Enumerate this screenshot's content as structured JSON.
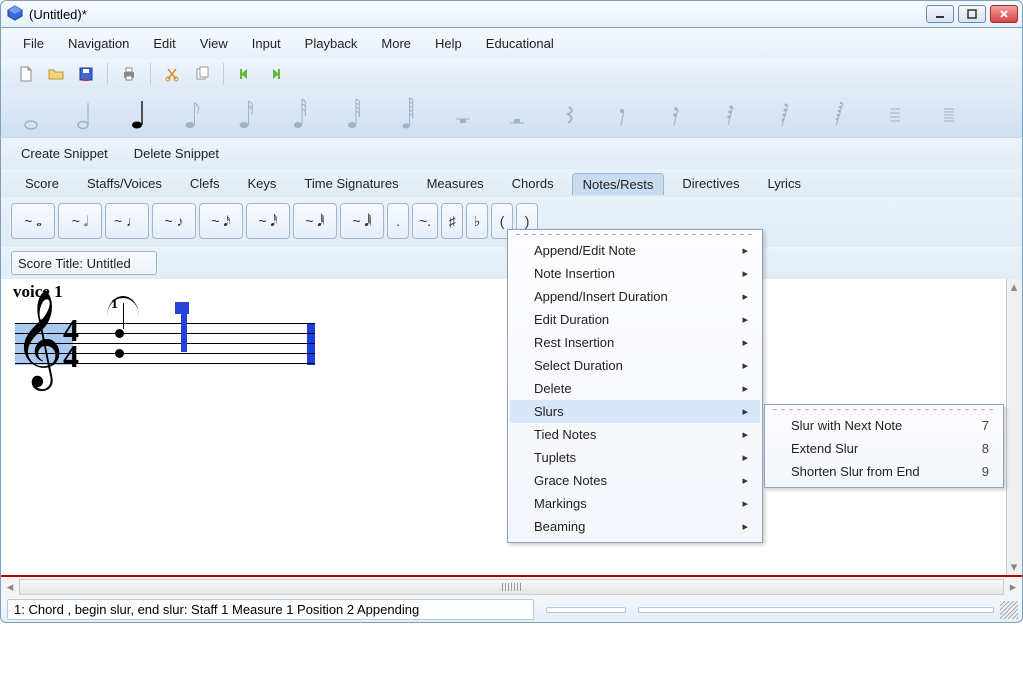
{
  "window": {
    "title": "(Untitled)*"
  },
  "menu": {
    "items": [
      "File",
      "Navigation",
      "Edit",
      "View",
      "Input",
      "Playback",
      "More",
      "Help",
      "Educational"
    ]
  },
  "snippet": {
    "create": "Create Snippet",
    "delete": "Delete Snippet"
  },
  "tabs": {
    "items": [
      "Score",
      "Staffs/Voices",
      "Clefs",
      "Keys",
      "Time Signatures",
      "Measures",
      "Chords",
      "Notes/Rests",
      "Directives",
      "Lyrics"
    ],
    "active_index": 7
  },
  "palette": {
    "items": [
      "~ 𝅝",
      "~ 𝅗𝅥",
      "~ ♩",
      "~ ♪",
      "~ 𝅘𝅥𝅯",
      "~ 𝅘𝅥𝅰",
      "~ 𝅘𝅥𝅱",
      "~ 𝅘𝅥𝅲",
      ".",
      "~.",
      "♯",
      "♭",
      "(",
      ")"
    ]
  },
  "score": {
    "title_input": "Score Title: Untitled",
    "voice_label": "voice 1",
    "clef": "𝄞",
    "time_top": "4",
    "time_bottom": "4",
    "small_num": "1"
  },
  "ctx_main": {
    "items": [
      "Append/Edit Note",
      "Note Insertion",
      "Append/Insert Duration",
      "Edit Duration",
      "Rest Insertion",
      "Select Duration",
      "Delete",
      "Slurs",
      "Tied Notes",
      "Tuplets",
      "Grace Notes",
      "Markings",
      "Beaming"
    ],
    "hover_index": 7
  },
  "ctx_sub": {
    "items": [
      {
        "label": "Slur with Next Note",
        "key": "7"
      },
      {
        "label": "Extend Slur",
        "key": "8"
      },
      {
        "label": "Shorten Slur from End",
        "key": "9"
      }
    ]
  },
  "status": {
    "text": "1: Chord , begin slur, end slur:  Staff 1 Measure 1 Position 2 Appending"
  },
  "colors": {
    "accent": "#2643d9"
  }
}
